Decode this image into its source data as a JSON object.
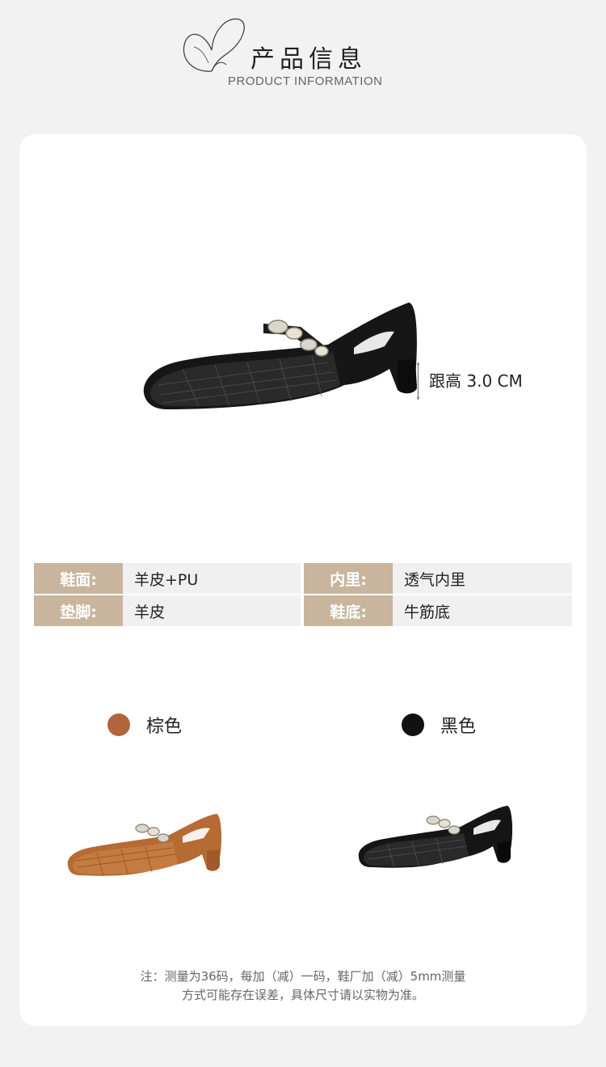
{
  "header": {
    "title_cn": "产品信息",
    "title_en": "PRODUCT INFORMATION"
  },
  "product": {
    "heel_height": "跟高 3.0 CM"
  },
  "specs": [
    [
      {
        "key": "鞋面:",
        "value": "羊皮+PU"
      },
      {
        "key": "内里:",
        "value": "透气内里"
      }
    ],
    [
      {
        "key": "垫脚:",
        "value": "羊皮"
      },
      {
        "key": "鞋底:",
        "value": "牛筋底"
      }
    ]
  ],
  "colors": [
    {
      "label": "棕色",
      "swatch": "#b0653a",
      "icon": "brown-swatch"
    },
    {
      "label": "黑色",
      "swatch": "#111111",
      "icon": "black-swatch"
    }
  ],
  "note": {
    "line1": "注：测量为36码，每加（减）一码，鞋厂加（减）5mm测量",
    "line2": "方式可能存在误差，具体尺寸请以实物为准。"
  },
  "theme": {
    "accent": "#c9b59d",
    "page_bg": "#f2f2f2"
  }
}
